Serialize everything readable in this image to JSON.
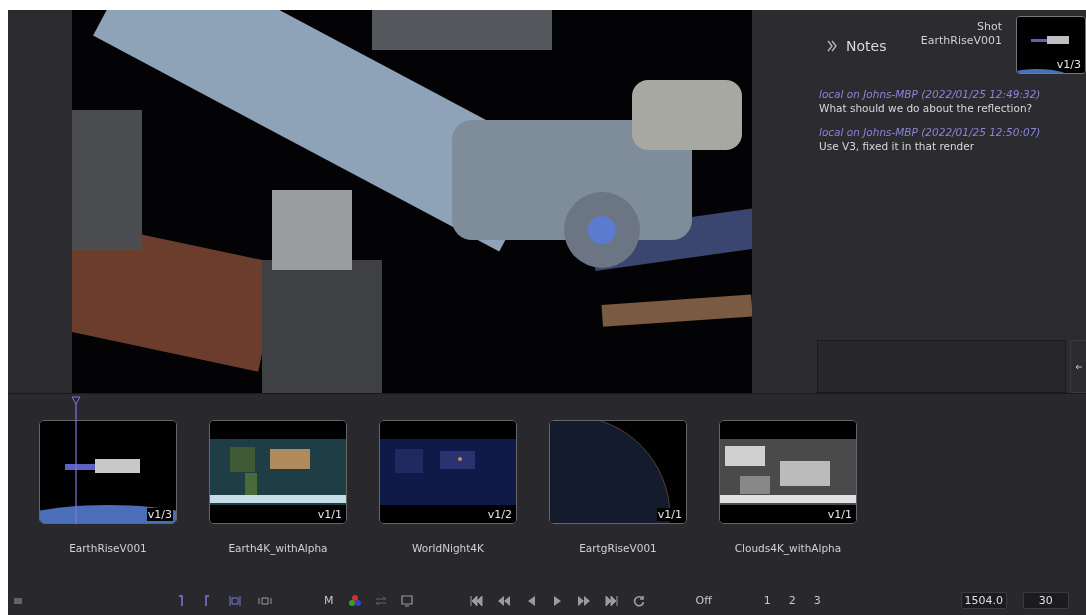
{
  "notes_panel": {
    "title": "Notes",
    "shot_label": "Shot",
    "shot_name": "EarthRiseV001",
    "shot_version": "v1/3",
    "notes": [
      {
        "author": "local on Johns-MBP (2022/01/25 12:49:32)",
        "text": "What should we do about the reflection?"
      },
      {
        "author": "local on Johns-MBP (2022/01/25 12:50:07)",
        "text": "Use V3, fixed it in that render"
      }
    ]
  },
  "clips": [
    {
      "name": "EarthRiseV001",
      "version": "v1/3",
      "current": true
    },
    {
      "name": "Earth4K_withAlpha",
      "version": "v1/1",
      "current": false
    },
    {
      "name": "WorldNight4K",
      "version": "v1/2",
      "current": false
    },
    {
      "name": "EartgRiseV001",
      "version": "v1/1",
      "current": false
    },
    {
      "name": "Clouds4K_withAlpha",
      "version": "v1/1",
      "current": false
    }
  ],
  "toolbar": {
    "view_mode": "M",
    "sync": "Off",
    "guides": [
      "1",
      "2",
      "3"
    ],
    "frame": "1504.0",
    "fps": "30"
  }
}
